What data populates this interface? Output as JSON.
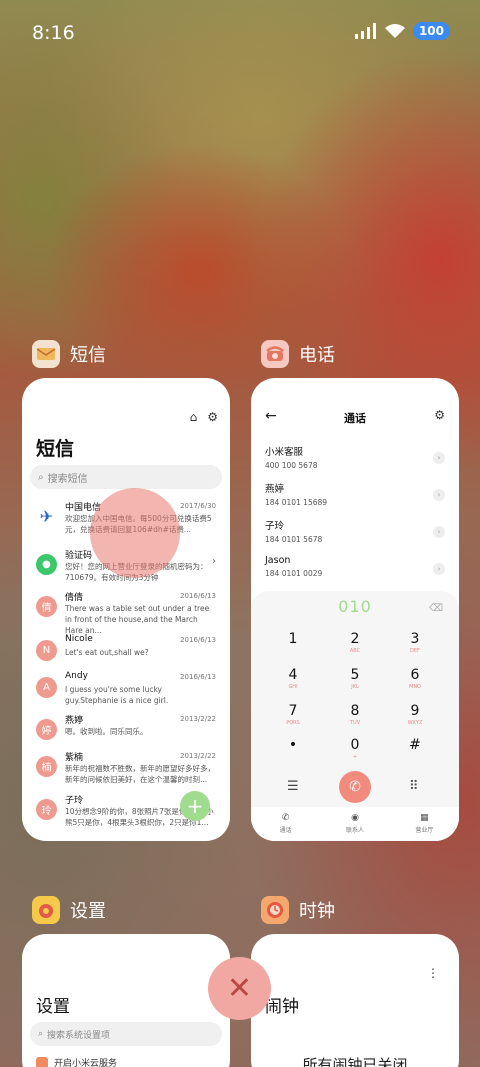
{
  "status": {
    "time": "8:16",
    "battery": "100"
  },
  "apps": [
    {
      "name": "短信"
    },
    {
      "name": "电话"
    },
    {
      "name": "设置"
    },
    {
      "name": "时钟"
    }
  ],
  "sms": {
    "title": "短信",
    "search_placeholder": "搜索短信",
    "messages": [
      {
        "avatar": "",
        "avatar_color": "#2a67c9",
        "name": "中国电信",
        "date": "2017/6/30",
        "preview": "欢迎您加入中国电信。每500分可兑换话费5元，兑换话费请回复106#dh#话费..."
      },
      {
        "avatar": "",
        "avatar_color": "#3cc76a",
        "name": "验证码",
        "date": "",
        "preview": "您好！您的网上营业厅登录的随机密码为：710679。有效时间为3分钟"
      },
      {
        "avatar": "倩",
        "avatar_color": "#ef9a8e",
        "name": "倩倩",
        "date": "2016/6/13",
        "preview": "There was a table set out under a tree in front of the house,and the March Hare an..."
      },
      {
        "avatar": "N",
        "avatar_color": "#ef9a8e",
        "name": "Nicole",
        "date": "2016/6/13",
        "preview": "Let's eat out,shall we?"
      },
      {
        "avatar": "A",
        "avatar_color": "#ef9a8e",
        "name": "Andy",
        "date": "2016/6/13",
        "preview": "I guess you're some lucky guy.Stephanie is a nice girl."
      },
      {
        "avatar": "婷",
        "avatar_color": "#ef9a8e",
        "name": "燕婷",
        "date": "2013/2/22",
        "preview": "嗯。收到啦。同乐同乐。"
      },
      {
        "avatar": "楠",
        "avatar_color": "#ef9a8e",
        "name": "紫楠",
        "date": "2013/2/22",
        "preview": "新年的祝福数不胜数，新年的愿望好多好多，新年的问候依旧美好，在这个温馨的时刻..."
      },
      {
        "avatar": "玲",
        "avatar_color": "#ef9a8e",
        "name": "子玲",
        "date": "",
        "preview": "10分想念9阶的你，8张照片7张是你，6只小熊5只是你，4根果头3根织你，2只是你1..."
      }
    ]
  },
  "phone": {
    "title": "通话",
    "contacts": [
      {
        "name": "小米客服",
        "number": "400 100 5678"
      },
      {
        "name": "燕婷",
        "number": "184 0101 15689"
      },
      {
        "name": "子玲",
        "number": "184 0101 5678"
      },
      {
        "name": "Jason",
        "number": "184 0101 0029"
      }
    ],
    "dial_display": "010",
    "keys": [
      {
        "num": "1",
        "sub": ""
      },
      {
        "num": "2",
        "sub": "ABC"
      },
      {
        "num": "3",
        "sub": "DEF"
      },
      {
        "num": "4",
        "sub": "GHI"
      },
      {
        "num": "5",
        "sub": "JKL"
      },
      {
        "num": "6",
        "sub": "MNO"
      },
      {
        "num": "7",
        "sub": "PQRS"
      },
      {
        "num": "8",
        "sub": "TUV"
      },
      {
        "num": "9",
        "sub": "WXYZ"
      },
      {
        "num": "•",
        "sub": ""
      },
      {
        "num": "0",
        "sub": "+"
      },
      {
        "num": "#",
        "sub": ""
      }
    ],
    "tabs": [
      {
        "icon": "phone",
        "label": "通话"
      },
      {
        "icon": "contacts",
        "label": "联系人"
      },
      {
        "icon": "store",
        "label": "营业厅"
      }
    ]
  },
  "settings": {
    "title": "设置",
    "search_placeholder": "搜索系统设置项",
    "first_item": "开启小米云服务"
  },
  "clock": {
    "title": "闹钟",
    "empty_text": "所有闹钟已关闭"
  }
}
